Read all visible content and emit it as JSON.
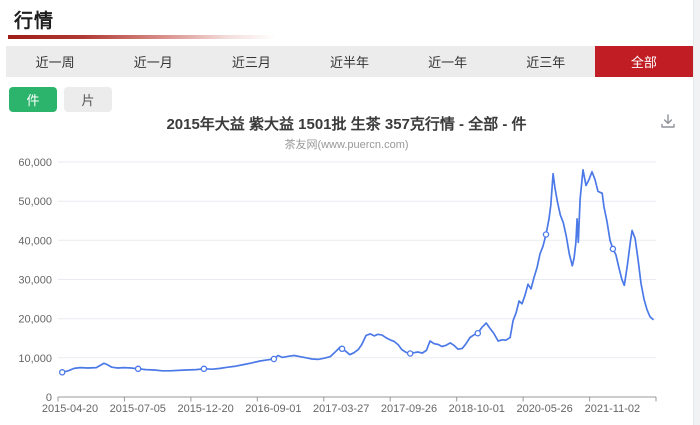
{
  "page": {
    "title": "行情"
  },
  "tabs": {
    "items": [
      "近一周",
      "近一月",
      "近三月",
      "近半年",
      "近一年",
      "近三年",
      "全部"
    ],
    "active_index": 6
  },
  "unit_toggle": {
    "options": [
      "件",
      "片"
    ],
    "active_index": 0
  },
  "icons": {
    "download": "download-icon"
  },
  "colors": {
    "accent_red": "#c01e24",
    "accent_green": "#2cb46c",
    "tab_bg": "#ececec",
    "line_blue": "#4b79e8",
    "grid_line": "#e8ebf1",
    "axis_line": "#999999",
    "axis_text": "#666666"
  },
  "chart_data": {
    "type": "line",
    "title": "2015年大益 紫大益 1501批 生茶 357克行情 - 全部 - 件",
    "subtitle": "茶友网(www.puercn.com)",
    "legend": "none",
    "grid": true,
    "ylim": [
      0,
      60000
    ],
    "y_ticks": [
      0,
      10000,
      20000,
      30000,
      40000,
      50000,
      60000
    ],
    "x_tick_labels": [
      "2015-04-20",
      "2015-07-05",
      "2015-12-20",
      "2016-09-01",
      "2017-03-27",
      "2017-09-26",
      "2018-10-01",
      "2020-05-26",
      "2021-11-02"
    ],
    "points_x_as_fraction": true,
    "series": [
      {
        "name": "行情价",
        "points": [
          [
            0.007,
            6300
          ],
          [
            0.017,
            6700
          ],
          [
            0.027,
            7300
          ],
          [
            0.037,
            7500
          ],
          [
            0.05,
            7400
          ],
          [
            0.064,
            7500
          ],
          [
            0.077,
            8600
          ],
          [
            0.082,
            8300
          ],
          [
            0.09,
            7600
          ],
          [
            0.1,
            7400
          ],
          [
            0.11,
            7500
          ],
          [
            0.122,
            7400
          ],
          [
            0.134,
            7200
          ],
          [
            0.147,
            7000
          ],
          [
            0.161,
            6900
          ],
          [
            0.174,
            6700
          ],
          [
            0.187,
            6700
          ],
          [
            0.201,
            6800
          ],
          [
            0.214,
            6900
          ],
          [
            0.231,
            7000
          ],
          [
            0.244,
            7200
          ],
          [
            0.258,
            7100
          ],
          [
            0.271,
            7300
          ],
          [
            0.284,
            7600
          ],
          [
            0.298,
            7900
          ],
          [
            0.311,
            8300
          ],
          [
            0.324,
            8700
          ],
          [
            0.338,
            9200
          ],
          [
            0.351,
            9500
          ],
          [
            0.361,
            9700
          ],
          [
            0.368,
            10600
          ],
          [
            0.375,
            10100
          ],
          [
            0.385,
            10400
          ],
          [
            0.395,
            10600
          ],
          [
            0.405,
            10300
          ],
          [
            0.415,
            10000
          ],
          [
            0.425,
            9700
          ],
          [
            0.435,
            9600
          ],
          [
            0.445,
            9900
          ],
          [
            0.455,
            10300
          ],
          [
            0.463,
            11400
          ],
          [
            0.472,
            12800
          ],
          [
            0.475,
            12300
          ],
          [
            0.482,
            11600
          ],
          [
            0.488,
            10800
          ],
          [
            0.495,
            11300
          ],
          [
            0.502,
            12100
          ],
          [
            0.508,
            13400
          ],
          [
            0.515,
            15700
          ],
          [
            0.522,
            16100
          ],
          [
            0.529,
            15600
          ],
          [
            0.535,
            16000
          ],
          [
            0.542,
            15800
          ],
          [
            0.549,
            15100
          ],
          [
            0.555,
            14600
          ],
          [
            0.562,
            14200
          ],
          [
            0.569,
            13300
          ],
          [
            0.575,
            12100
          ],
          [
            0.582,
            11400
          ],
          [
            0.589,
            11100
          ],
          [
            0.595,
            11300
          ],
          [
            0.602,
            11500
          ],
          [
            0.609,
            11200
          ],
          [
            0.616,
            11900
          ],
          [
            0.622,
            14300
          ],
          [
            0.629,
            13600
          ],
          [
            0.636,
            13400
          ],
          [
            0.642,
            12900
          ],
          [
            0.649,
            13200
          ],
          [
            0.656,
            13800
          ],
          [
            0.662,
            13200
          ],
          [
            0.669,
            12200
          ],
          [
            0.676,
            12400
          ],
          [
            0.682,
            13500
          ],
          [
            0.689,
            15200
          ],
          [
            0.696,
            15900
          ],
          [
            0.702,
            16300
          ],
          [
            0.709,
            17800
          ],
          [
            0.716,
            18900
          ],
          [
            0.722,
            17600
          ],
          [
            0.729,
            16200
          ],
          [
            0.736,
            14300
          ],
          [
            0.743,
            14600
          ],
          [
            0.749,
            14500
          ],
          [
            0.756,
            15200
          ],
          [
            0.761,
            19500
          ],
          [
            0.766,
            21500
          ],
          [
            0.771,
            24500
          ],
          [
            0.776,
            23800
          ],
          [
            0.781,
            26000
          ],
          [
            0.786,
            28800
          ],
          [
            0.791,
            27600
          ],
          [
            0.796,
            30500
          ],
          [
            0.801,
            33000
          ],
          [
            0.806,
            36500
          ],
          [
            0.811,
            38500
          ],
          [
            0.816,
            41500
          ],
          [
            0.821,
            45500
          ],
          [
            0.824,
            49000
          ],
          [
            0.828,
            57000
          ],
          [
            0.831,
            53500
          ],
          [
            0.835,
            50000
          ],
          [
            0.84,
            46500
          ],
          [
            0.845,
            44500
          ],
          [
            0.85,
            41000
          ],
          [
            0.855,
            36500
          ],
          [
            0.86,
            33500
          ],
          [
            0.863,
            35500
          ],
          [
            0.866,
            39500
          ],
          [
            0.868,
            45500
          ],
          [
            0.87,
            39500
          ],
          [
            0.873,
            50500
          ],
          [
            0.878,
            58000
          ],
          [
            0.883,
            54000
          ],
          [
            0.888,
            55500
          ],
          [
            0.893,
            57500
          ],
          [
            0.898,
            55500
          ],
          [
            0.903,
            52500
          ],
          [
            0.91,
            52000
          ],
          [
            0.913,
            48500
          ],
          [
            0.918,
            44800
          ],
          [
            0.923,
            40000
          ],
          [
            0.928,
            37800
          ],
          [
            0.933,
            36300
          ],
          [
            0.938,
            33000
          ],
          [
            0.943,
            30000
          ],
          [
            0.947,
            28500
          ],
          [
            0.952,
            33500
          ],
          [
            0.957,
            39500
          ],
          [
            0.96,
            42500
          ],
          [
            0.965,
            40500
          ],
          [
            0.97,
            35000
          ],
          [
            0.975,
            29000
          ],
          [
            0.98,
            25000
          ],
          [
            0.985,
            22300
          ],
          [
            0.99,
            20500
          ],
          [
            0.995,
            19800
          ]
        ],
        "markers": [
          [
            0.007,
            6300
          ],
          [
            0.134,
            7200
          ],
          [
            0.244,
            7200
          ],
          [
            0.361,
            9700
          ],
          [
            0.475,
            12300
          ],
          [
            0.589,
            11100
          ],
          [
            0.702,
            16300
          ],
          [
            0.816,
            41500
          ],
          [
            0.928,
            37800
          ]
        ]
      }
    ]
  }
}
